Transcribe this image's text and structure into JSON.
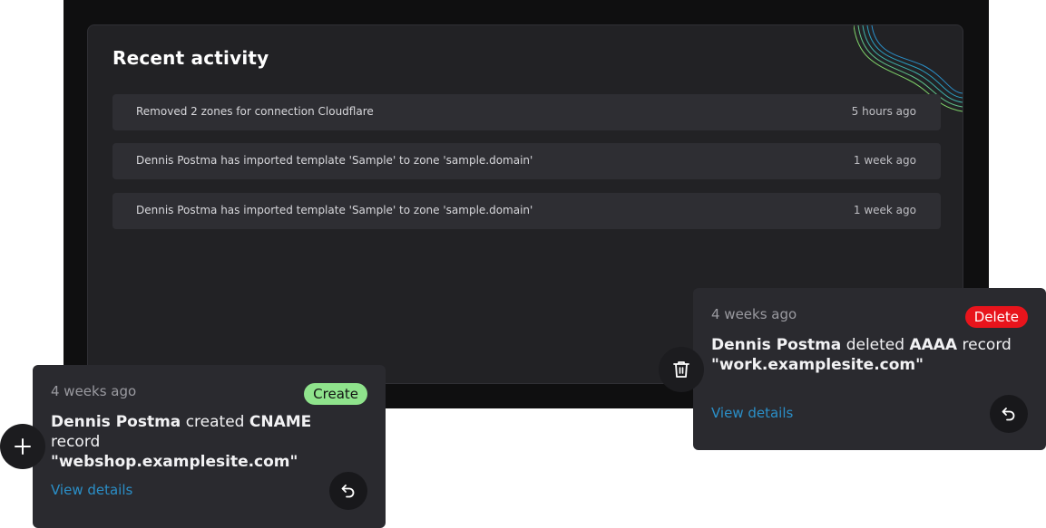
{
  "recent": {
    "title": "Recent activity",
    "items": [
      {
        "message": "Removed 2 zones for connection Cloudflare",
        "time": "5 hours ago"
      },
      {
        "message": "Dennis Postma has imported template 'Sample' to zone 'sample.domain'",
        "time": "1 week ago"
      },
      {
        "message": "Dennis Postma has imported template 'Sample' to zone 'sample.domain'",
        "time": "1 week ago"
      }
    ]
  },
  "create_card": {
    "time": "4 weeks ago",
    "badge": "Create",
    "badge_color": "#8fe38c",
    "user": "Dennis Postma",
    "action": "created",
    "record_type": "CNAME",
    "record_word": "record",
    "record_name": "\"webshop.examplesite.com\"",
    "details_label": "View details",
    "left_icon": "plus-icon",
    "undo_icon": "undo-icon"
  },
  "delete_card": {
    "time": "4 weeks ago",
    "badge": "Delete",
    "badge_color": "#e8141c",
    "user": "Dennis Postma",
    "action": "deleted",
    "record_type": "AAAA",
    "record_word": "record",
    "record_name": "\"work.examplesite.com\"",
    "details_label": "View details",
    "left_icon": "trash-icon",
    "undo_icon": "undo-icon"
  },
  "colors": {
    "link": "#2a8fc8",
    "panel": "#222225",
    "card": "#2a2a2f"
  }
}
